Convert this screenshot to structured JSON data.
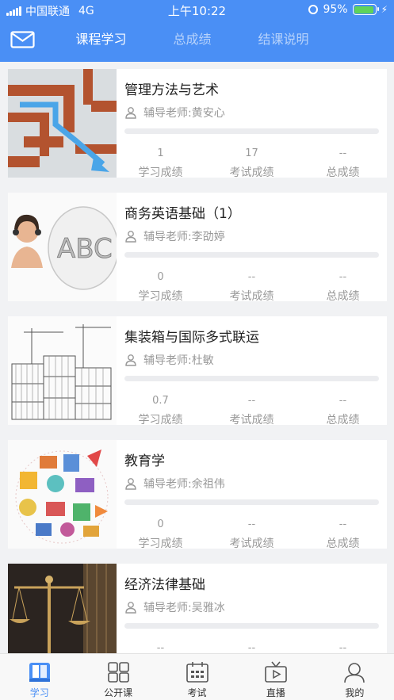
{
  "status": {
    "carrier": "中国联通",
    "network": "4G",
    "time": "上午10:22",
    "battery": "95%",
    "battery_level": 0.95
  },
  "header": {
    "tabs": [
      {
        "label": "课程学习",
        "active": true
      },
      {
        "label": "总成绩",
        "active": false
      },
      {
        "label": "结课说明",
        "active": false
      }
    ]
  },
  "courses": [
    {
      "title": "管理方法与艺术",
      "teacher": "辅导老师:黄安心",
      "study_score": "1",
      "exam_score": "17",
      "total_score": "--",
      "image": "maze-image"
    },
    {
      "title": "商务英语基础（1）",
      "teacher": "辅导老师:李劭婷",
      "study_score": "0",
      "exam_score": "--",
      "total_score": "--",
      "image": "abc-education-image"
    },
    {
      "title": "集装箱与国际多式联运",
      "teacher": "辅导老师:杜敏",
      "study_score": "0.7",
      "exam_score": "--",
      "total_score": "--",
      "image": "containers-image"
    },
    {
      "title": "教育学",
      "teacher": "辅导老师:余祖伟",
      "study_score": "0",
      "exam_score": "--",
      "total_score": "--",
      "image": "education-icons-image"
    },
    {
      "title": "经济法律基础",
      "teacher": "辅导老师:吴雅冰",
      "study_score": "--",
      "exam_score": "--",
      "total_score": "--",
      "image": "scales-image"
    }
  ],
  "score_labels": {
    "study": "学习成绩",
    "exam": "考试成绩",
    "total": "总成绩"
  },
  "tabbar": {
    "items": [
      {
        "label": "学习",
        "icon": "book-icon",
        "active": true
      },
      {
        "label": "公开课",
        "icon": "grid-icon",
        "active": false
      },
      {
        "label": "考试",
        "icon": "calendar-icon",
        "active": false
      },
      {
        "label": "直播",
        "icon": "tv-icon",
        "active": false
      },
      {
        "label": "我的",
        "icon": "user-icon",
        "active": false
      }
    ]
  },
  "colors": {
    "primary": "#4a8ff5",
    "background": "#f1f2f4",
    "muted_text": "#999999",
    "battery": "#5fd35a"
  }
}
